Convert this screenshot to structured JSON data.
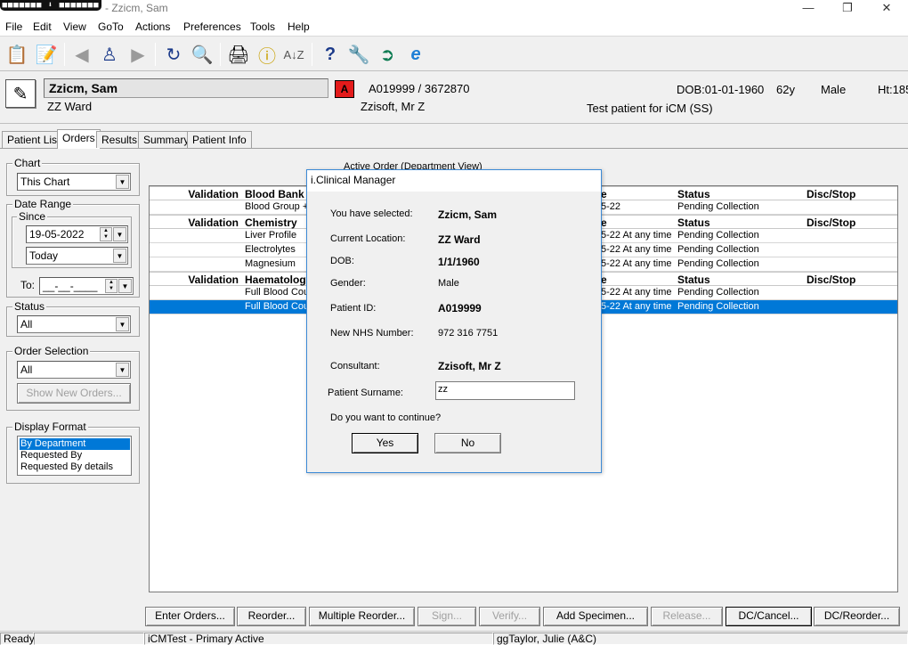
{
  "window": {
    "title": "- Zzicm, Sam",
    "blackbox_text": "■■■■■■■ ⬇ ■■■■■■■"
  },
  "menu": [
    "File",
    "Edit",
    "View",
    "GoTo",
    "Actions",
    "Preferences",
    "Tools",
    "Help"
  ],
  "toolbar_icons": [
    "patient-list-icon",
    "patient-details-icon",
    "back-arrow-icon",
    "people-icon",
    "forward-arrow-icon",
    "refresh-icon",
    "search-icon",
    "print-icon",
    "info-icon",
    "sort-az-icon",
    "help-icon",
    "tools-icon",
    "exit-icon",
    "internet-explorer-icon"
  ],
  "patient": {
    "name": "Zzicm, Sam",
    "ward": "ZZ Ward",
    "alert": "A",
    "ids": "A019999 / 3672870",
    "consultant": "Zzisoft, Mr Z",
    "dob": "DOB:01-01-1960",
    "age": "62y",
    "sex": "Male",
    "height": "Ht:185",
    "note": "Test patient for iCM (SS)"
  },
  "tabs": [
    "Patient List",
    "Orders",
    "Results",
    "Summary",
    "Patient Info"
  ],
  "filters": {
    "chart": {
      "label": "Chart",
      "value": "This Chart"
    },
    "date_range": {
      "label": "Date Range",
      "since_label": "Since",
      "since_value": "19-05-2022",
      "period_value": "Today",
      "to_label": "To:",
      "to_value": "__-__-____"
    },
    "status": {
      "label": "Status",
      "value": "All"
    },
    "order_selection": {
      "label": "Order Selection",
      "value": "All",
      "button": "Show New Orders..."
    },
    "display_format": {
      "label": "Display Format",
      "options": [
        "By Department",
        "Requested By",
        "Requested By details"
      ],
      "selected_index": 0
    }
  },
  "grid": {
    "caption": "Active Order (Department View)",
    "rows": [
      {
        "type": "hdr",
        "validation": "Validation",
        "name": "Blood Bank",
        "date": "e",
        "status": "Status",
        "disc": "Disc/Stop"
      },
      {
        "type": "item",
        "validation": "",
        "name": "Blood Group +",
        "date": "5-22",
        "status": "Pending Collection",
        "disc": ""
      },
      {
        "type": "hdr",
        "validation": "Validation",
        "name": "Chemistry",
        "date": "e",
        "status": "Status",
        "disc": "Disc/Stop"
      },
      {
        "type": "item",
        "validation": "",
        "name": "Liver Profile",
        "date": "5-22 At any time",
        "status": "Pending Collection",
        "disc": ""
      },
      {
        "type": "item",
        "validation": "",
        "name": "Electrolytes",
        "date": "5-22 At any time",
        "status": "Pending Collection",
        "disc": ""
      },
      {
        "type": "item",
        "validation": "",
        "name": "Magnesium",
        "date": "5-22 At any time",
        "status": "Pending Collection",
        "disc": ""
      },
      {
        "type": "hdr",
        "validation": "Validation",
        "name": "Haematology",
        "date": "e",
        "status": "Status",
        "disc": "Disc/Stop"
      },
      {
        "type": "item",
        "validation": "",
        "name": "Full Blood Count",
        "date": "5-22 At any time",
        "status": "Pending Collection",
        "disc": ""
      },
      {
        "type": "item selected",
        "validation": "",
        "name": "Full Blood Count",
        "date": "5-22 At any time",
        "status": "Pending Collection",
        "disc": ""
      }
    ]
  },
  "bottom_buttons": [
    {
      "label": "Enter Orders...",
      "enabled": true
    },
    {
      "label": "Reorder...",
      "enabled": true
    },
    {
      "label": "Multiple Reorder...",
      "enabled": true
    },
    {
      "label": "Sign...",
      "enabled": false
    },
    {
      "label": "Verify...",
      "enabled": false
    },
    {
      "label": "Add Specimen...",
      "enabled": true
    },
    {
      "label": "Release...",
      "enabled": false
    },
    {
      "label": "DC/Cancel...",
      "enabled": true
    },
    {
      "label": "DC/Reorder...",
      "enabled": true
    }
  ],
  "statusbar": {
    "state": "Ready",
    "env": "iCMTest - Primary Active",
    "user": "ggTaylor, Julie  (A&C)"
  },
  "dialog": {
    "title": "i.Clinical Manager",
    "selected_label": "You have selected:",
    "selected_value": "Zzicm, Sam",
    "location_label": "Current Location:",
    "location_value": "ZZ Ward",
    "dob_label": "DOB:",
    "dob_value": "1/1/1960",
    "gender_label": "Gender:",
    "gender_value": "Male",
    "pid_label": "Patient ID:",
    "pid_value": "A019999",
    "nhs_label": "New NHS Number:",
    "nhs_value": "972 316 7751",
    "consultant_label": "Consultant:",
    "consultant_value": "Zzisoft, Mr Z",
    "surname_label": "Patient Surname:",
    "surname_value": "zz",
    "question": "Do you want to continue?",
    "yes": "Yes",
    "no": "No"
  },
  "colors": {
    "selection": "#0078d7",
    "alert": "#e31b1b",
    "dialog_border": "#3c8ad6"
  }
}
